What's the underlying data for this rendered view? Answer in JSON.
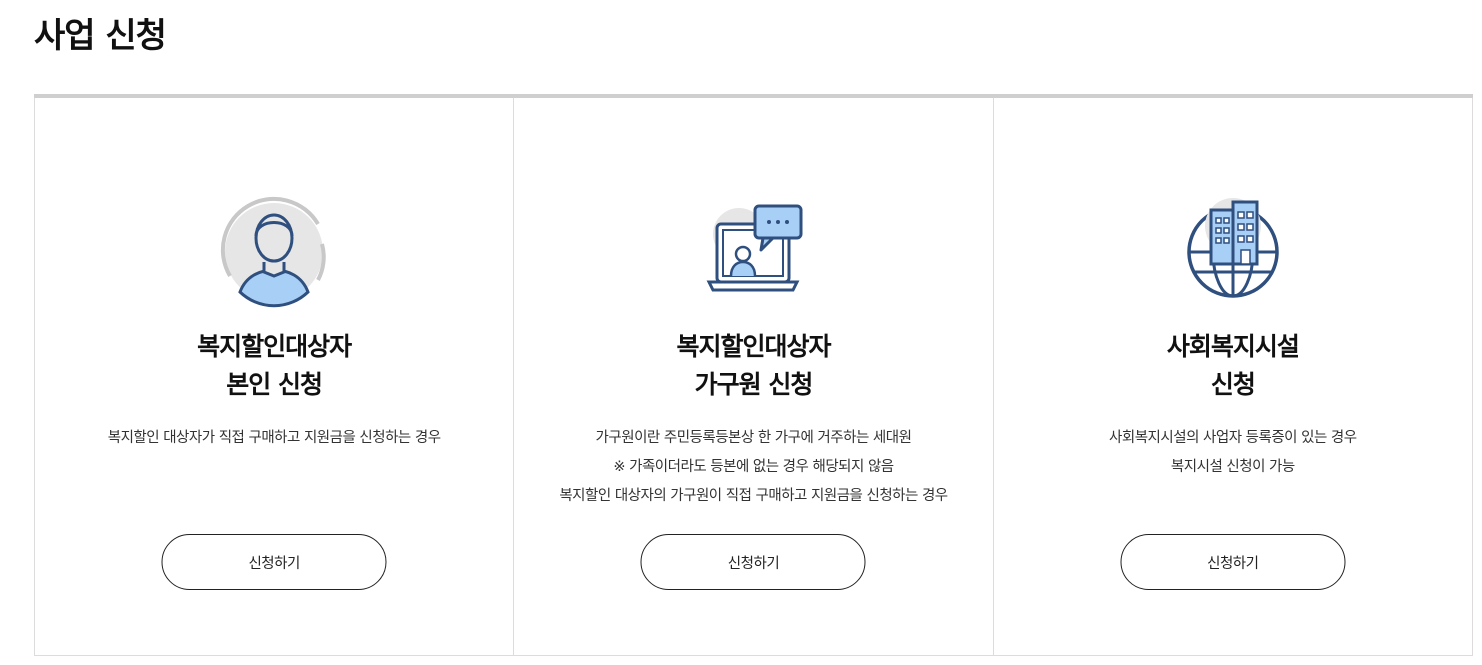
{
  "page": {
    "title": "사업 신청"
  },
  "cards": [
    {
      "icon": "person-avatar-icon",
      "title_lines": [
        "복지할인대상자",
        "본인 신청"
      ],
      "desc_lines": [
        "복지할인 대상자가 직접 구매하고 지원금을 신청하는 경우"
      ],
      "button_label": "신청하기"
    },
    {
      "icon": "laptop-chat-icon",
      "title_lines": [
        "복지할인대상자",
        "가구원 신청"
      ],
      "desc_lines": [
        "가구원이란 주민등록등본상 한 가구에 거주하는 세대원",
        "※ 가족이더라도 등본에 없는 경우 해당되지 않음",
        "복지할인 대상자의 가구원이 직접 구매하고 지원금을 신청하는 경우"
      ],
      "button_label": "신청하기"
    },
    {
      "icon": "building-globe-icon",
      "title_lines": [
        "사회복지시설",
        "신청"
      ],
      "desc_lines": [
        "사회복지시설의 사업자 등록증이 있는 경우",
        "복지시설 신청이 가능"
      ],
      "button_label": "신청하기"
    }
  ],
  "colors": {
    "icon_stroke": "#2f4f7f",
    "icon_fill": "#a8cff5",
    "icon_bg": "#e6e6e6",
    "top_border": "#cfcfcf"
  }
}
